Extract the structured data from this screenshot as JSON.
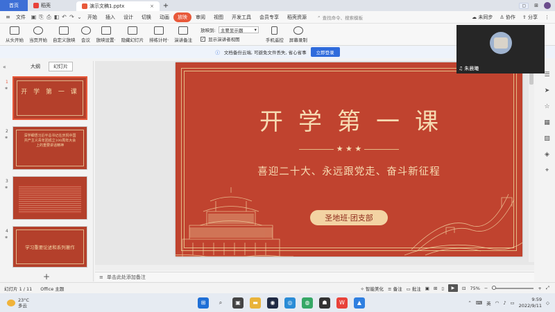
{
  "titlebar": {
    "home_tab": "首页",
    "docer_tab": "稻壳",
    "doc_tab": "演示文稿1.pptx",
    "plus": "+",
    "close": "×"
  },
  "menubar": {
    "file": "文件",
    "items": [
      "开始",
      "插入",
      "设计",
      "切换",
      "动画",
      "放映",
      "审阅",
      "视图",
      "开发工具",
      "会员专享",
      "稻壳资源"
    ],
    "active_item": "放映",
    "search_placeholder": "查找命令、搜索模板",
    "sync": "未同步",
    "collab": "协作",
    "share": "分享"
  },
  "ribbon": {
    "buttons": [
      "从头开始",
      "当页开始",
      "自定义放映",
      "会议",
      "放映设置·",
      "隐藏幻灯片",
      "排练计时·",
      "演讲备注"
    ],
    "show_on_label": "放映到:",
    "show_on_value": "主要显示器",
    "presenter_view_label": "显示演讲者视图",
    "phone_remote": "手机遥控",
    "screen_record": "屏幕录制"
  },
  "notice": {
    "text": "文档备份云端, 可避免文件丢失, 省心省事",
    "button": "立即登录"
  },
  "leftpane": {
    "tab_outline": "大纲",
    "tab_slides": "幻灯片",
    "thumbnails": [
      {
        "num": "1",
        "title": "开 学 第 一 课"
      },
      {
        "num": "2",
        "title": "深学细悟习近平总书记在庆祝中国共产主义青年团成立100周年大会上的重要讲话精神"
      },
      {
        "num": "3",
        "title": ""
      },
      {
        "num": "4",
        "title": "学习重要论述和系列著作"
      }
    ],
    "add": "+"
  },
  "slide": {
    "title": "开学第一课",
    "stars": "★ ★ ★",
    "subtitle": "喜迎二十大、永远跟党走、奋斗新征程",
    "badge": "圣地班·团支部"
  },
  "notes": {
    "placeholder": "单击此处添加备注"
  },
  "statusbar": {
    "slide_info": "幻灯片 1 / 11",
    "theme": "Office 主题",
    "beautify": "智能美化",
    "notes": "备注",
    "comments": "批注",
    "zoom": "75%"
  },
  "video": {
    "name": "朱晨曦"
  },
  "taskbar": {
    "temp": "23°C",
    "weather": "多云",
    "lang": "英",
    "time": "9:59",
    "date": "2022/9/11"
  },
  "colors": {
    "slide_bg": "#c0432f",
    "gold": "#f6dbb2",
    "accent": "#e8593a"
  }
}
